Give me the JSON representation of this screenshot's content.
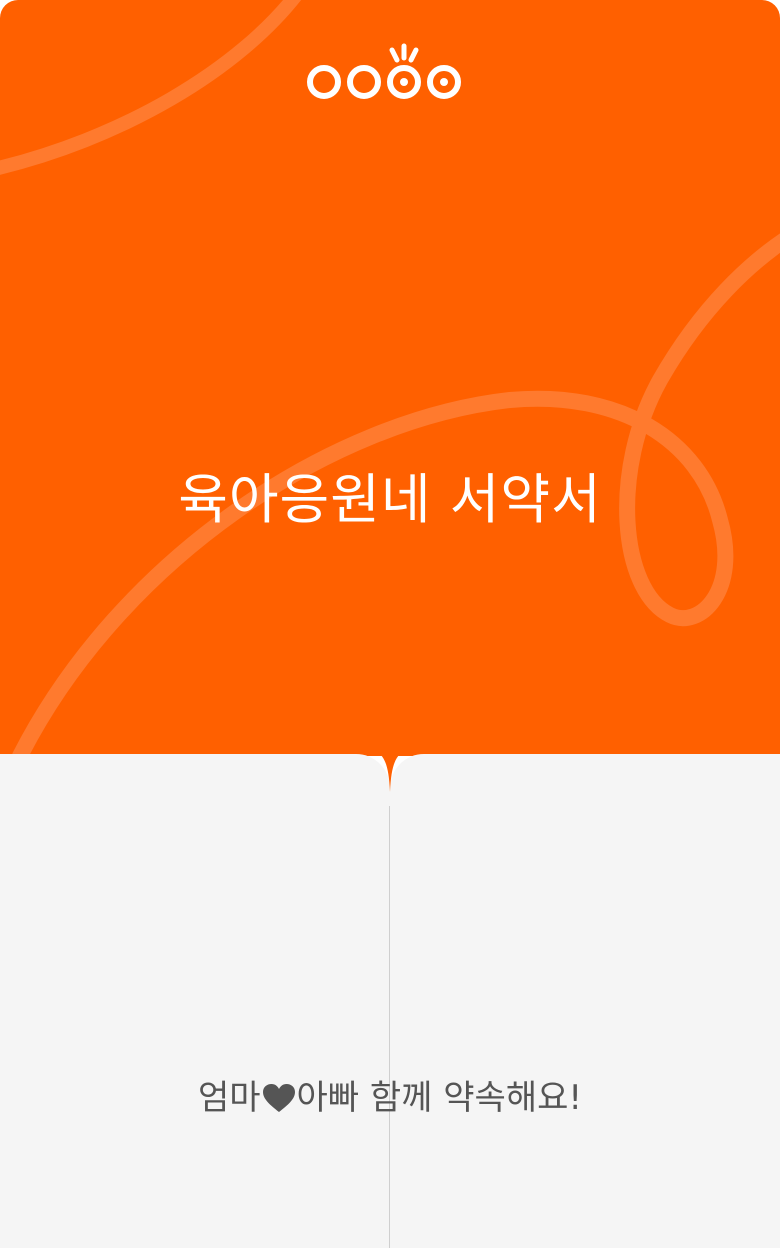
{
  "brand": {
    "logo_icon": "oo-brand-logo-icon",
    "accent_color": "#FF6000",
    "panel_color": "#F5F5F5"
  },
  "header": {
    "title": "육아응원네 서약서"
  },
  "footer": {
    "subtitle_before": "엄마",
    "subtitle_heart_icon": "heart-icon",
    "subtitle_after": "아빠 함께 약속해요!"
  }
}
